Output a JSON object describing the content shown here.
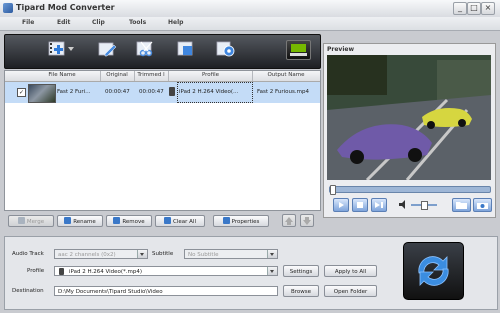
{
  "window": {
    "title": "Tipard Mod Converter",
    "minimize": "_",
    "maximize": "□",
    "close": "×"
  },
  "menu": [
    "File",
    "Edit",
    "Clip",
    "Tools",
    "Help"
  ],
  "toolbar": {
    "icons": [
      "add-file-icon",
      "edit-icon",
      "clip-icon",
      "merge-3d-icon",
      "preferences-icon",
      "nvidia-cuda-icon"
    ]
  },
  "file_list": {
    "columns": [
      "File Name",
      "Original",
      "Trimmed l",
      "Profile",
      "Output Name"
    ],
    "rows": [
      {
        "checked": "✓",
        "file_name": "Fast 2 Furi…",
        "original": "00:00:47",
        "trimmed": "00:00:47",
        "profile": "iPad 2 H.264 Video(…",
        "output_name": "Fast 2 Furious.mp4"
      }
    ]
  },
  "actions": {
    "merge": "Merge",
    "rename": "Rename",
    "remove": "Remove",
    "clear_all": "Clear All",
    "properties": "Properties"
  },
  "preview": {
    "label": "Preview",
    "progress": 0.0
  },
  "settings": {
    "audio_track_label": "Audio Track",
    "audio_track_value": "aac 2 channels (0x2)",
    "subtitle_label": "Subtitle",
    "subtitle_value": "No Subtitle",
    "profile_label": "Profile",
    "profile_value": "iPad 2 H.264 Video(*.mp4)",
    "settings_button": "Settings",
    "apply_all_button": "Apply to All",
    "destination_label": "Destination",
    "destination_value": "D:\\My Documents\\Tipard Studio\\Video",
    "browse_button": "Browse",
    "open_folder_button": "Open Folder"
  },
  "colors": {
    "selection": "#c4dcf7",
    "convert_arrows": "#3b8de0",
    "accent": "#3a78c8"
  }
}
